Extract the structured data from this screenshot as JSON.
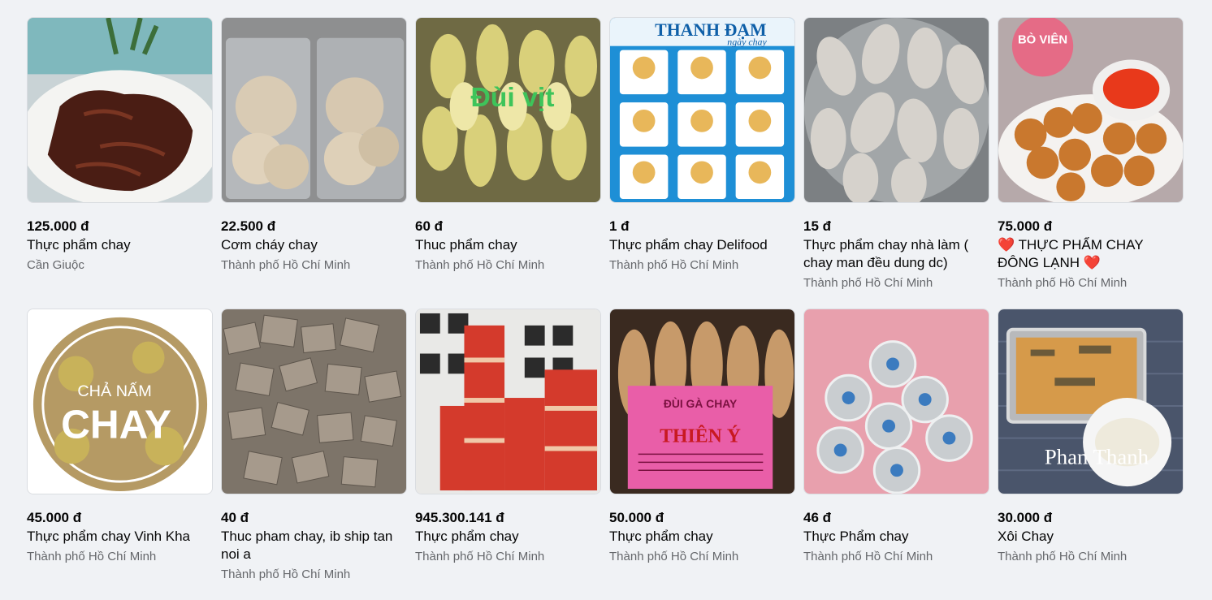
{
  "listings": [
    {
      "price": "125.000 đ",
      "title": "Thực phẩm chay",
      "location": "Cần Giuộc"
    },
    {
      "price": "22.500 đ",
      "title": "Cơm cháy chay",
      "location": "Thành phố Hồ Chí Minh"
    },
    {
      "price": "60 đ",
      "title": "Thuc phẩm chay",
      "location": "Thành phố Hồ Chí Minh",
      "image_text": "Đùi vịt"
    },
    {
      "price": "1 đ",
      "title": "Thực phẩm chay Delifood",
      "location": "Thành phố Hồ Chí Minh",
      "image_text": "THANH ĐẠM",
      "image_subtext": "ngày chay"
    },
    {
      "price": "15 đ",
      "title": "Thực phẩm chay nhà làm ( chay man đều dung dc)",
      "location": "Thành phố Hồ Chí Minh"
    },
    {
      "price": "75.000 đ",
      "title": "THỰC PHẨM CHAY ĐÔNG LẠNH",
      "title_prefix": "❤️",
      "title_suffix": "❤️",
      "location": "Thành phố Hồ Chí Minh",
      "image_text": "BÒ VIÊN"
    },
    {
      "price": "45.000 đ",
      "title": "Thực phẩm chay Vinh Kha",
      "location": "Thành phố Hồ Chí Minh",
      "image_text": "CHẢ NẤM",
      "image_subtext": "CHAY"
    },
    {
      "price": "40 đ",
      "title": "Thuc pham chay, ib ship tan noi a",
      "location": "Thành phố Hồ Chí Minh"
    },
    {
      "price": "945.300.141 đ",
      "title": "Thực phẩm chay",
      "location": "Thành phố Hồ Chí Minh"
    },
    {
      "price": "50.000 đ",
      "title": "Thực phẩm chay",
      "location": "Thành phố Hồ Chí Minh",
      "image_text": "ĐÙI GÀ CHAY",
      "image_subtext": "THIÊN Ý"
    },
    {
      "price": "46 đ",
      "title": "Thực Phẩm chay",
      "location": "Thành phố Hồ Chí Minh"
    },
    {
      "price": "30.000 đ",
      "title": "Xôi Chay",
      "location": "Thành phố Hồ Chí Minh",
      "image_text": "Phan Thanh"
    }
  ]
}
